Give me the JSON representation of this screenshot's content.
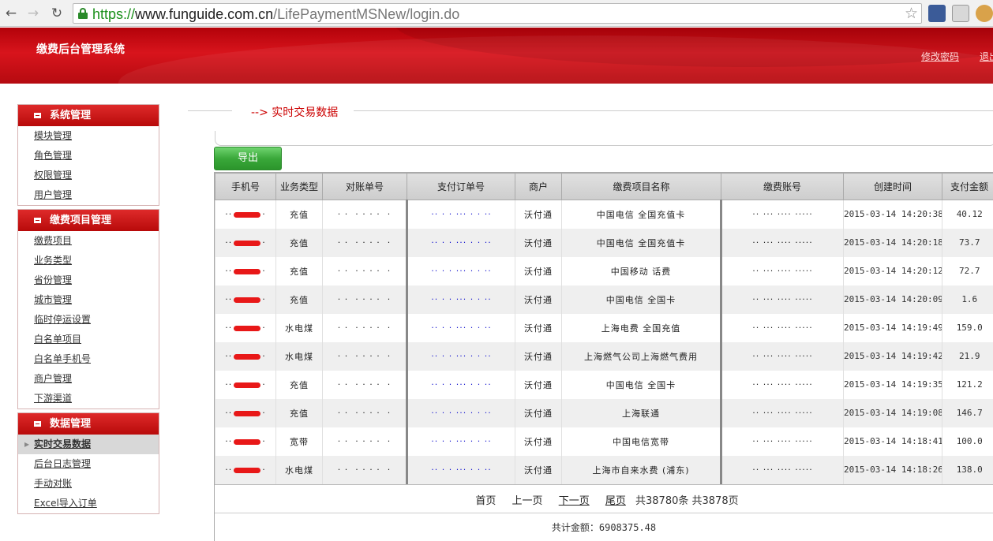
{
  "browser": {
    "url_scheme": "https://",
    "url_host": "www.funguide.com.cn",
    "url_path": "/LifePaymentMSNew/login.do"
  },
  "header": {
    "system_title": "缴费后台管理系统",
    "change_password": "修改密码",
    "logout": "退出"
  },
  "sidebar": [
    {
      "title": "系统管理",
      "items": [
        "模块管理",
        "角色管理",
        "权限管理",
        "用户管理"
      ]
    },
    {
      "title": "缴费项目管理",
      "items": [
        "缴费项目",
        "业务类型",
        "省份管理",
        "城市管理",
        "临时停运设置",
        "白名单项目",
        "白名单手机号",
        "商户管理",
        "下游渠道"
      ]
    },
    {
      "title": "数据管理",
      "items": [
        "实时交易数据",
        "后台日志管理",
        "手动对账",
        "Excel导入订单"
      ],
      "active_index": 0
    }
  ],
  "breadcrumb": "--> 实时交易数据",
  "export_label": "导出",
  "table": {
    "columns": [
      "手机号",
      "业务类型",
      "对账单号",
      "支付订单号",
      "商户",
      "缴费项目名称",
      "缴费账号",
      "创建时间",
      "支付金额"
    ],
    "rows": [
      {
        "biz": "充值",
        "merchant": "沃付通",
        "item": "中国电信 全国充值卡",
        "created": "2015-03-14 14:20:38",
        "amount": "40.12"
      },
      {
        "biz": "充值",
        "merchant": "沃付通",
        "item": "中国电信 全国充值卡",
        "created": "2015-03-14 14:20:18",
        "amount": "73.7"
      },
      {
        "biz": "充值",
        "merchant": "沃付通",
        "item": "中国移动 话费",
        "created": "2015-03-14 14:20:12",
        "amount": "72.7"
      },
      {
        "biz": "充值",
        "merchant": "沃付通",
        "item": "中国电信 全国卡",
        "created": "2015-03-14 14:20:09",
        "amount": "1.6"
      },
      {
        "biz": "水电煤",
        "merchant": "沃付通",
        "item": "上海电费 全国充值",
        "created": "2015-03-14 14:19:49",
        "amount": "159.0"
      },
      {
        "biz": "水电煤",
        "merchant": "沃付通",
        "item": "上海燃气公司上海燃气费用",
        "created": "2015-03-14 14:19:42",
        "amount": "21.9"
      },
      {
        "biz": "充值",
        "merchant": "沃付通",
        "item": "中国电信 全国卡",
        "created": "2015-03-14 14:19:35",
        "amount": "121.2"
      },
      {
        "biz": "充值",
        "merchant": "沃付通",
        "item": "上海联通",
        "created": "2015-03-14 14:19:08",
        "amount": "146.7"
      },
      {
        "biz": "宽带",
        "merchant": "沃付通",
        "item": "中国电信宽带",
        "created": "2015-03-14 14:18:41",
        "amount": "100.0"
      },
      {
        "biz": "水电煤",
        "merchant": "沃付通",
        "item": "上海市自来水费 (浦东)",
        "created": "2015-03-14 14:18:26",
        "amount": "138.0"
      }
    ]
  },
  "pager": {
    "first": "首页",
    "prev": "上一页",
    "next": "下一页",
    "last": "尾页",
    "summary": "共38780条 共3878页"
  },
  "total": {
    "label": "共计金额：",
    "value": "6908375.48"
  }
}
